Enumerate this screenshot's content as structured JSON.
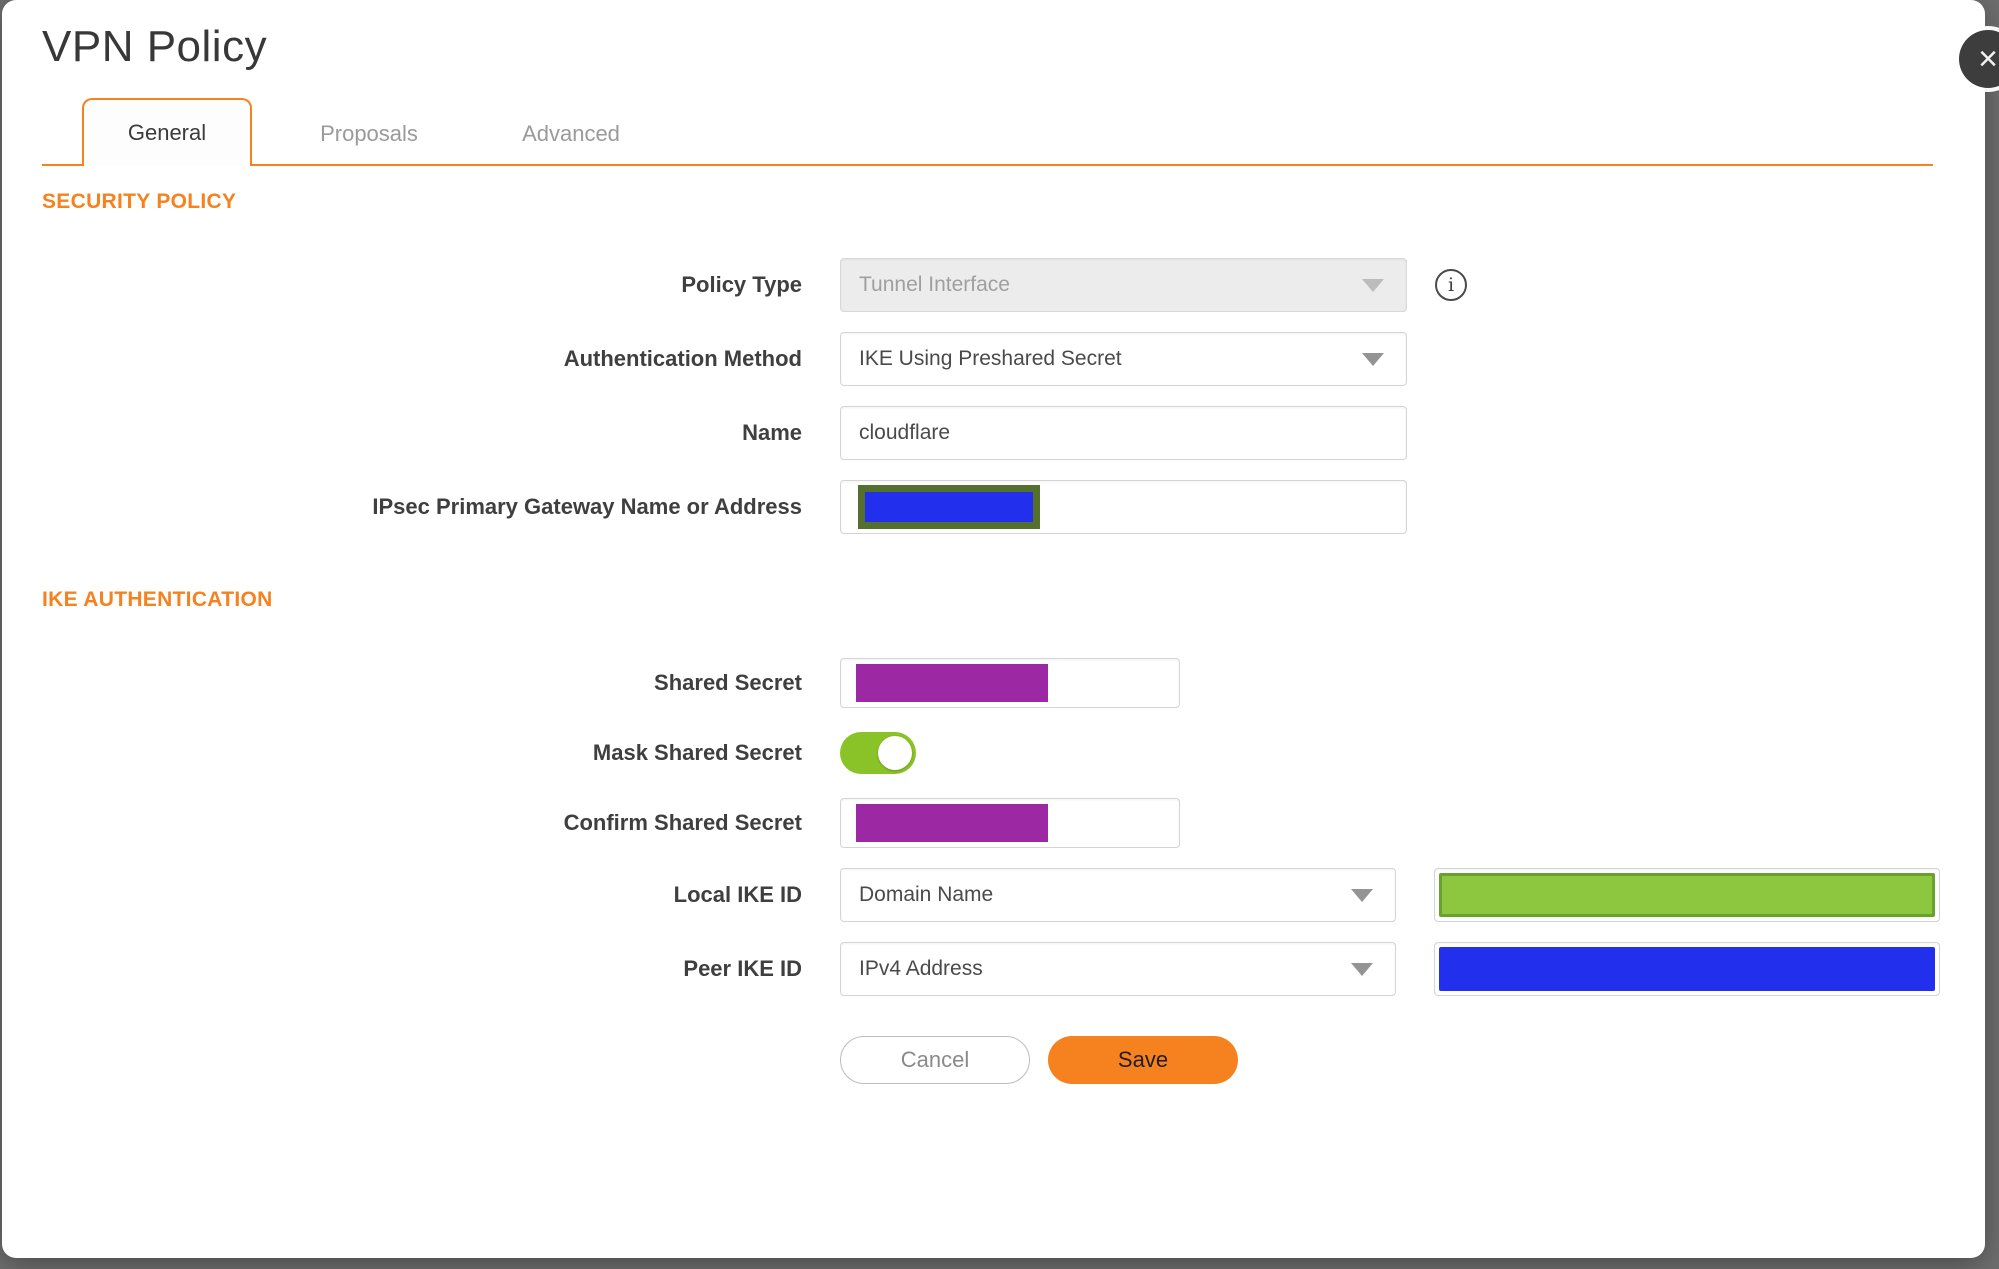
{
  "dialog": {
    "title": "VPN Policy"
  },
  "icons": {
    "close": "×",
    "info": "i"
  },
  "tabs": {
    "general": "General",
    "proposals": "Proposals",
    "advanced": "Advanced",
    "active_tab": "General"
  },
  "security_policy": {
    "heading": "SECURITY POLICY",
    "policy_type": {
      "label": "Policy Type",
      "value": "Tunnel Interface",
      "disabled": true
    },
    "authentication_method": {
      "label": "Authentication Method",
      "value": "IKE Using Preshared Secret"
    },
    "name": {
      "label": "Name",
      "value": "cloudflare"
    },
    "gateway": {
      "label": "IPsec Primary Gateway Name or Address",
      "value_redacted": true
    }
  },
  "ike_authentication": {
    "heading": "IKE AUTHENTICATION",
    "shared_secret": {
      "label": "Shared Secret",
      "value_redacted": true
    },
    "mask_shared_secret": {
      "label": "Mask Shared Secret",
      "state": "on"
    },
    "confirm_shared_secret": {
      "label": "Confirm Shared Secret",
      "value_redacted": true
    },
    "local_ike_id": {
      "label": "Local IKE ID",
      "type": "Domain Name",
      "value_redacted": true
    },
    "peer_ike_id": {
      "label": "Peer IKE ID",
      "type": "IPv4 Address",
      "value_redacted": true
    }
  },
  "buttons": {
    "cancel": "Cancel",
    "save": "Save"
  },
  "colors": {
    "accent": "#f6821f",
    "redaction_blue": "#2230ee",
    "redaction_purple": "#9c28a4",
    "redaction_green": "#8dc63f",
    "redaction_green_border": "#67a22c",
    "gateway_redaction_border": "#55702c",
    "toggle_on": "#8ac327",
    "backdrop": "#6f6f6f"
  }
}
